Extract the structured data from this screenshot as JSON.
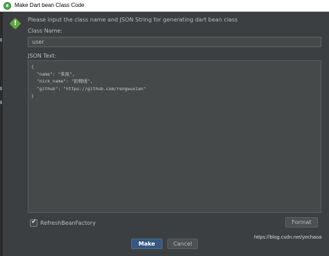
{
  "window": {
    "title": "Make Dart bean Class Code"
  },
  "dialog": {
    "description": "Please input the class name and JSON String for generating dart bean class",
    "class_name_label": "Class Name:",
    "class_name_value": "user",
    "json_label": "JSON Text:",
    "json_lines": [
      "{",
      "  \"name\": \"朱凯\",",
      "  \"nick_name\": \"扔物线\",",
      "  \"github\": \"https://github.com/rengwuxian\"",
      "}"
    ],
    "checkbox_label": "RefreshBeanFactory",
    "checkbox_checked": true,
    "format_button": "Format",
    "make_button": "Make",
    "cancel_button": "Cancel"
  },
  "watermark": "https://blog.csdn.net/yechaoa",
  "colors": {
    "dialog_bg": "#3c3f41",
    "input_bg": "#45494a",
    "primary_button": "#365880",
    "icon_green": "#5fa83f"
  },
  "icons": {
    "app": "android-studio-icon",
    "info": "green-diamond-icon",
    "checkbox": "checkmark-icon"
  }
}
